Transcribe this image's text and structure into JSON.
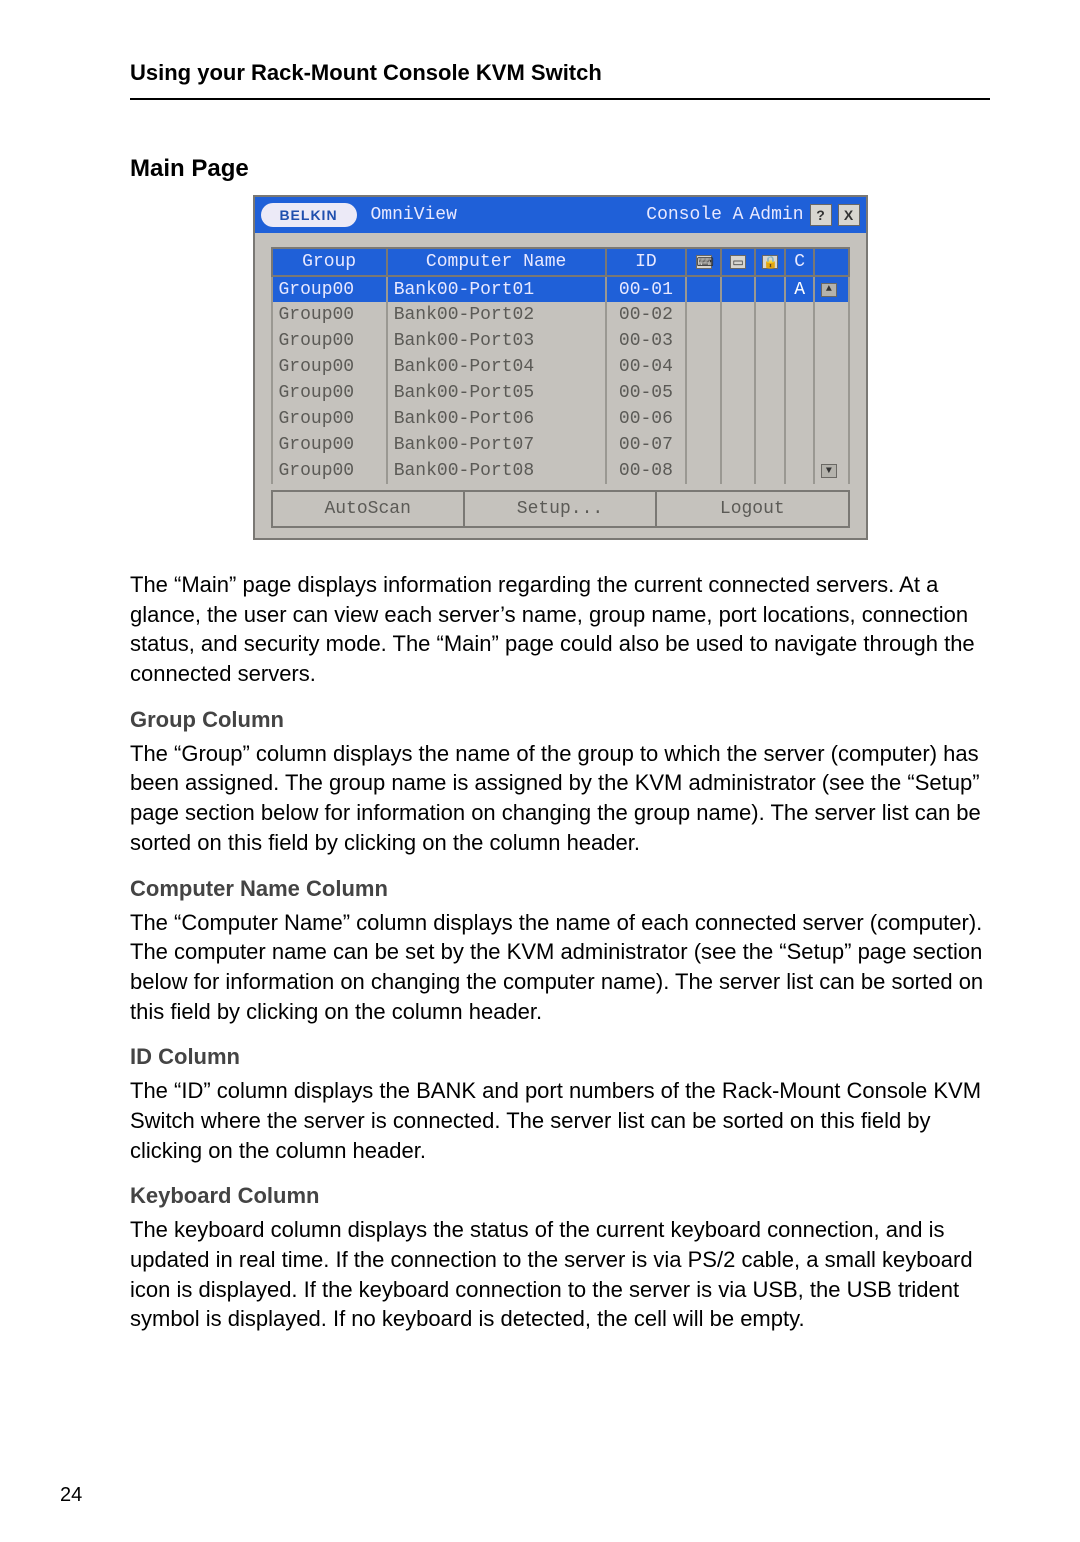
{
  "doc": {
    "header": "Using your Rack-Mount Console KVM Switch",
    "page_number": "24",
    "sections": {
      "main_title": "Main Page",
      "main_body": "The “Main” page displays information regarding the current connected servers. At a glance, the user can view each server’s name, group name, port locations, connection status, and security mode. The “Main” page could also be used to navigate through the connected servers.",
      "group_title": "Group Column",
      "group_body": "The “Group” column displays the name of the group to which the server (computer) has been assigned. The group name is assigned by the KVM administrator (see the “Setup” page section below for information on changing the group name). The server list can be sorted on this field by clicking on the column header.",
      "cname_title": "Computer Name Column",
      "cname_body": "The “Computer Name” column displays the name of each connected server (computer). The computer name can be set by the KVM administrator (see the “Setup” page section below for information on changing the computer name). The server list can be sorted on this field by clicking on the column header.",
      "id_title": "ID Column",
      "id_body": "The “ID” column displays the BANK and port numbers of the Rack-Mount Console KVM Switch where the server is connected. The server list can be sorted on this field by clicking on the column header.",
      "kbd_title": "Keyboard Column",
      "kbd_body": "The keyboard column displays the status of the current keyboard connection, and is updated in real time. If the connection to the server is via PS/2 cable, a small keyboard icon is displayed. If the keyboard connection to the server is via USB, the USB trident symbol is displayed. If no keyboard is detected, the cell will be empty."
    }
  },
  "osd": {
    "logo": "BELKIN",
    "product": "OmniView",
    "console_label": "Console A",
    "user_label": "Admin",
    "help_glyph": "?",
    "close_glyph": "X",
    "headers": {
      "group": "Group",
      "computer_name": "Computer Name",
      "id": "ID",
      "kbd_glyph": "⌨",
      "mouse_glyph": "▭",
      "lock_glyph": "🔒",
      "sec": "C",
      "conn": " "
    },
    "rows": [
      {
        "group": "Group00",
        "name": "Bank00-Port01",
        "id": "00-01",
        "sec": "A",
        "selected": true
      },
      {
        "group": "Group00",
        "name": "Bank00-Port02",
        "id": "00-02",
        "sec": "",
        "selected": false
      },
      {
        "group": "Group00",
        "name": "Bank00-Port03",
        "id": "00-03",
        "sec": "",
        "selected": false
      },
      {
        "group": "Group00",
        "name": "Bank00-Port04",
        "id": "00-04",
        "sec": "",
        "selected": false
      },
      {
        "group": "Group00",
        "name": "Bank00-Port05",
        "id": "00-05",
        "sec": "",
        "selected": false
      },
      {
        "group": "Group00",
        "name": "Bank00-Port06",
        "id": "00-06",
        "sec": "",
        "selected": false
      },
      {
        "group": "Group00",
        "name": "Bank00-Port07",
        "id": "00-07",
        "sec": "",
        "selected": false
      },
      {
        "group": "Group00",
        "name": "Bank00-Port08",
        "id": "00-08",
        "sec": "",
        "selected": false
      }
    ],
    "buttons": {
      "autoscan": "AutoScan",
      "setup": "Setup...",
      "logout": "Logout"
    },
    "scroll": {
      "up": "▲",
      "down": "▼"
    }
  }
}
